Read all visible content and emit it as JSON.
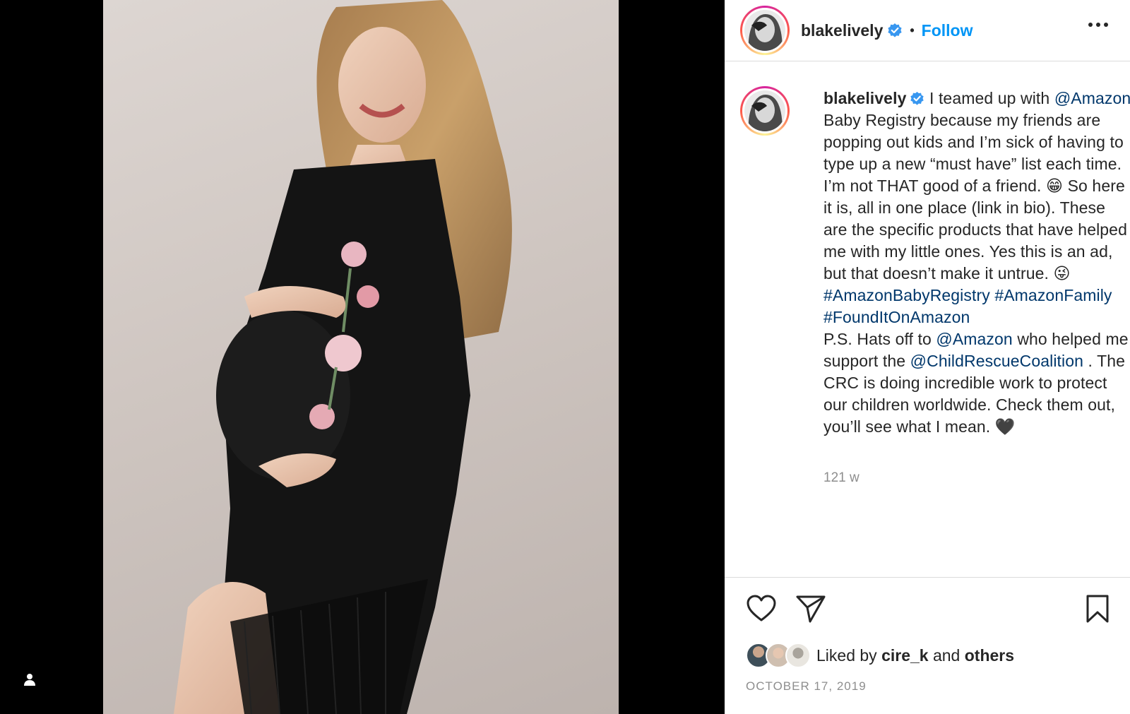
{
  "header": {
    "username": "blakelively",
    "separator": "•",
    "follow_label": "Follow"
  },
  "caption": {
    "username": "blakelively",
    "t1": " I teamed up with ",
    "m1": "@Amazon",
    "t2": " Baby Registry because my friends are popping out kids and I’m sick of having to type up a new “must have” list each time. I’m not THAT good of a friend. 😁 So here it is, all in one place (link in bio). These are the specific products that have helped me with my little ones. Yes this is an ad, but that doesn’t make it untrue. 😜 ",
    "h1": "#AmazonBabyRegistry",
    "h2": "#AmazonFamily",
    "h3": "#FoundItOnAmazon",
    "t3": "P.S. Hats off to ",
    "m2": "@Amazon",
    "t4": " who helped me support the ",
    "m3": "@ChildRescueCoalition",
    "t5": " . The CRC is doing incredible work to protect our children worldwide. Check them out, you’ll see what I mean. 🖤"
  },
  "time_ago": "121 w",
  "likes": {
    "prefix": "Liked by ",
    "user": "cire_k",
    "middle": " and ",
    "others": "others"
  },
  "date": "OCTOBER 17, 2019",
  "colors": {
    "follow": "#0095f6",
    "link": "#00376b",
    "verified": "#3897f0"
  }
}
